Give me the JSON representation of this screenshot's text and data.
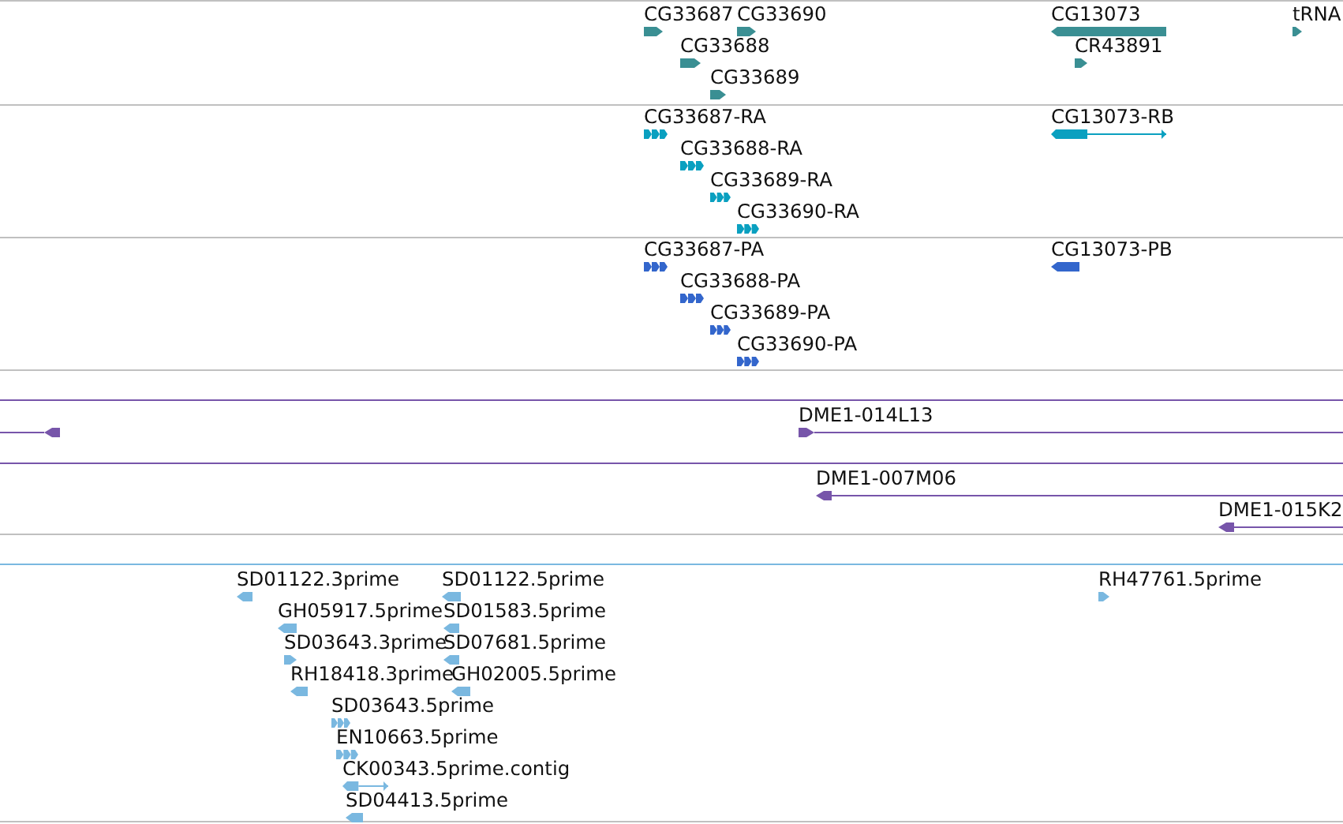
{
  "tracks": [
    {
      "color": "#3a8f93",
      "features": [
        {
          "label": "CG33687",
          "reverse": false,
          "kind": "block"
        },
        {
          "label": "CG33690",
          "reverse": false,
          "kind": "block"
        },
        {
          "label": "CG33688",
          "reverse": false,
          "kind": "block"
        },
        {
          "label": "CG33689",
          "reverse": false,
          "kind": "block"
        },
        {
          "label": "CG13073",
          "reverse": true,
          "kind": "block"
        },
        {
          "label": "CR43891",
          "reverse": false,
          "kind": "block"
        },
        {
          "label": "tRNA",
          "reverse": false,
          "kind": "block"
        }
      ]
    },
    {
      "color": "#0aa0c0",
      "features": [
        {
          "label": "CG33687-RA",
          "reverse": false,
          "kind": "exons"
        },
        {
          "label": "CG33688-RA",
          "reverse": false,
          "kind": "exons"
        },
        {
          "label": "CG33689-RA",
          "reverse": false,
          "kind": "exons"
        },
        {
          "label": "CG33690-RA",
          "reverse": false,
          "kind": "exons"
        },
        {
          "label": "CG13073-RB",
          "reverse": true,
          "kind": "transcript"
        }
      ]
    },
    {
      "color": "#3366cc",
      "features": [
        {
          "label": "CG33687-PA",
          "reverse": false,
          "kind": "exons"
        },
        {
          "label": "CG33688-PA",
          "reverse": false,
          "kind": "exons"
        },
        {
          "label": "CG33689-PA",
          "reverse": false,
          "kind": "exons"
        },
        {
          "label": "CG33690-PA",
          "reverse": false,
          "kind": "exons"
        },
        {
          "label": "CG13073-PB",
          "reverse": true,
          "kind": "block"
        }
      ]
    },
    {
      "color": "#7755aa",
      "features": [
        {
          "reverse": true,
          "kind": "clone"
        },
        {
          "label": "DME1-014L13",
          "reverse": false,
          "kind": "clone"
        }
      ]
    },
    {
      "color": "#7755aa",
      "features": [
        {
          "label": "DME1-007M06",
          "reverse": true,
          "kind": "clone"
        },
        {
          "label": "DME1-015K2",
          "reverse": true,
          "kind": "clone"
        }
      ]
    },
    {
      "color": "#7ab8e0",
      "features": [
        {
          "label": "SD01122.3prime",
          "reverse": true,
          "kind": "block"
        },
        {
          "label": "SD01122.5prime",
          "reverse": true,
          "kind": "block"
        },
        {
          "label": "GH05917.5prime",
          "reverse": true,
          "kind": "block"
        },
        {
          "label": "SD01583.5prime",
          "reverse": true,
          "kind": "block"
        },
        {
          "label": "SD03643.3prime",
          "reverse": false,
          "kind": "block"
        },
        {
          "label": "SD07681.5prime",
          "reverse": true,
          "kind": "block"
        },
        {
          "label": "RH18418.3prime",
          "reverse": true,
          "kind": "block"
        },
        {
          "label": "GH02005.5prime",
          "reverse": true,
          "kind": "block"
        },
        {
          "label": "SD03643.5prime",
          "reverse": false,
          "kind": "exons"
        },
        {
          "label": "EN10663.5prime",
          "reverse": false,
          "kind": "exons"
        },
        {
          "label": "CK00343.5prime.contig",
          "reverse": true,
          "kind": "transcript"
        },
        {
          "label": "SD04413.5prime",
          "reverse": true,
          "kind": "block"
        },
        {
          "label": "RH47761.5prime",
          "reverse": false,
          "kind": "block"
        }
      ]
    }
  ]
}
